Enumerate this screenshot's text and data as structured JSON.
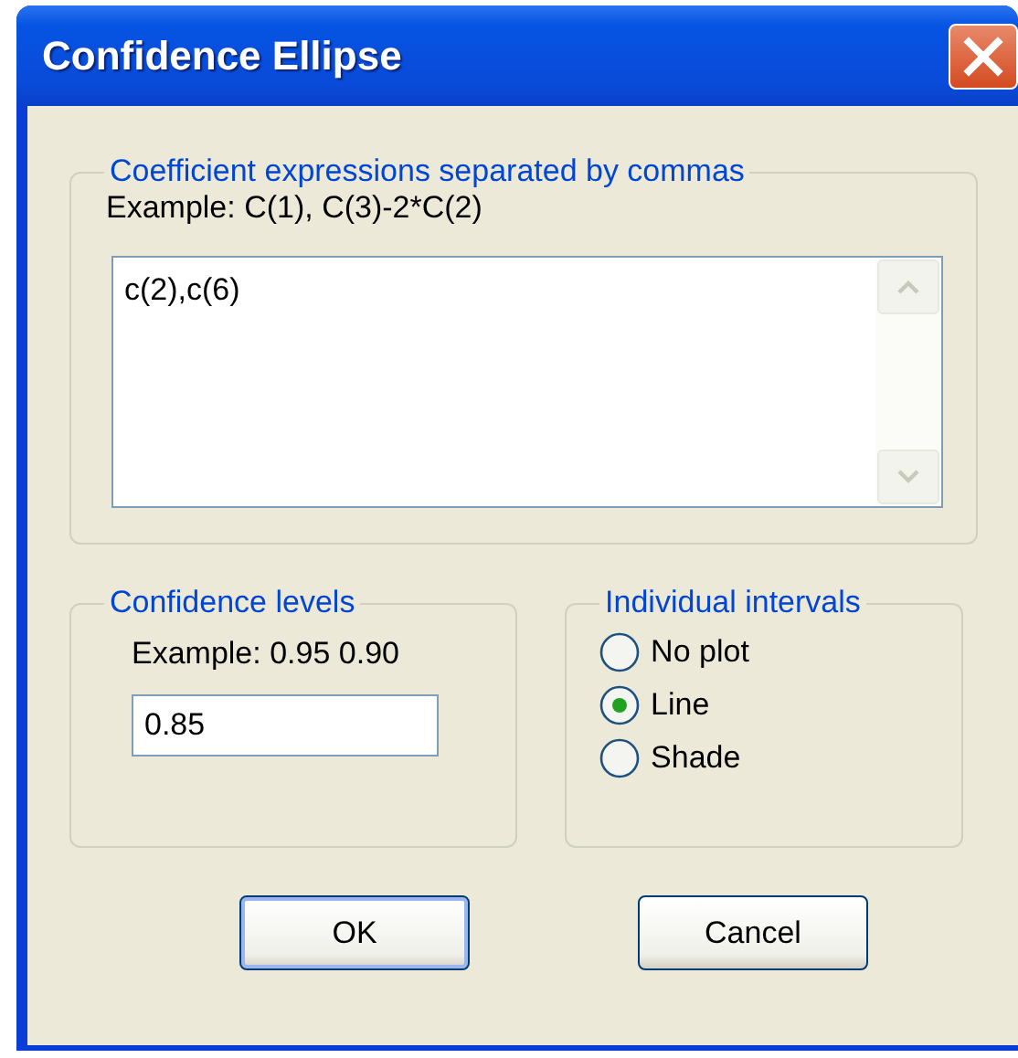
{
  "window": {
    "title": "Confidence Ellipse"
  },
  "coefficients": {
    "legend": "Coefficient expressions separated by commas",
    "example": "Example: C(1),  C(3)-2*C(2)",
    "value": "c(2),c(6)"
  },
  "confidence_levels": {
    "legend": "Confidence levels",
    "example": "Example: 0.95 0.90",
    "value": "0.85"
  },
  "individual_intervals": {
    "legend": "Individual intervals",
    "options": [
      {
        "label": "No plot",
        "selected": false
      },
      {
        "label": "Line",
        "selected": true
      },
      {
        "label": "Shade",
        "selected": false
      }
    ]
  },
  "buttons": [
    {
      "label": "OK",
      "default": true
    },
    {
      "label": "Cancel",
      "default": false
    }
  ]
}
